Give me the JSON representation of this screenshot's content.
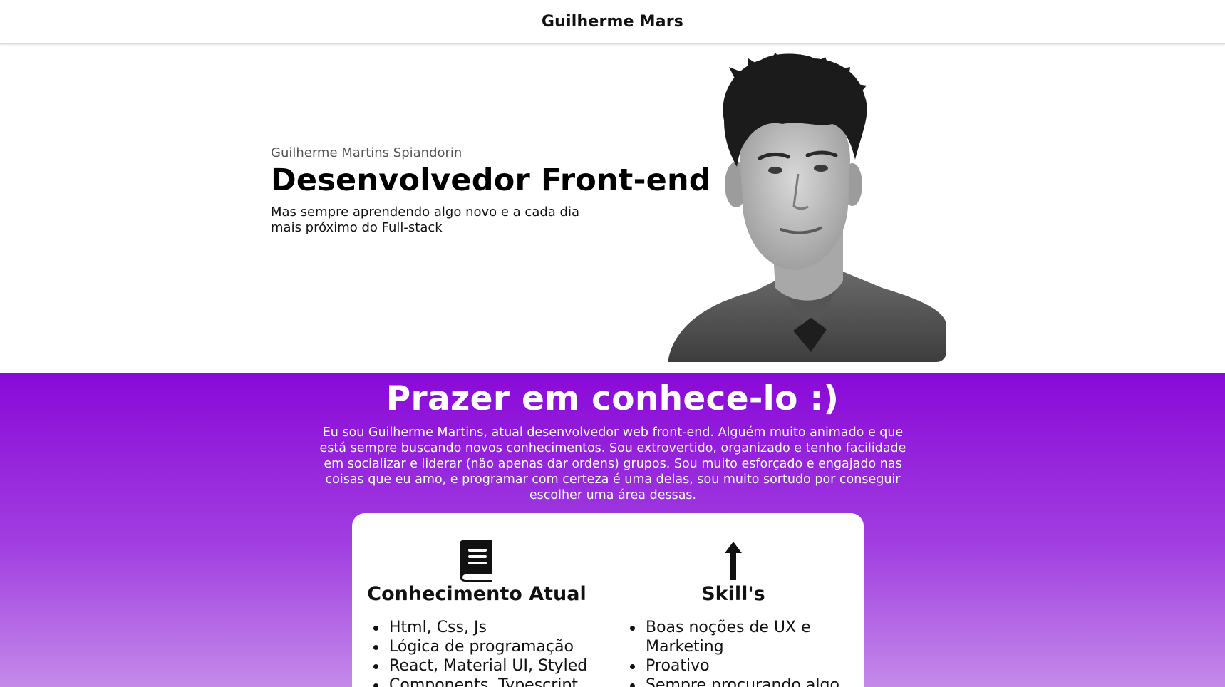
{
  "header": {
    "brand": "Guilherme Mars"
  },
  "hero": {
    "name": "Guilherme Martins Spiandorin",
    "title": "Desenvolvedor Front-end",
    "subtitle": "Mas sempre aprendendo algo novo e a cada dia mais próximo do Full-stack",
    "photo_icon": "profile-photo"
  },
  "about": {
    "title": "Prazer em conhece-lo :)",
    "text": "Eu sou Guilherme Martins, atual desenvolvedor web front-end. Alguém muito animado e que está sempre buscando novos conhecimentos. Sou extrovertido, organizado e tenho facilidade em socializar e liderar (não apenas dar ordens) grupos. Sou muito esforçado e engajado nas coisas que eu amo, e programar com certeza é uma delas, sou muito sortudo por conseguir escolher uma área dessas.",
    "colors": {
      "gradient_top": "#8a09d8",
      "gradient_bottom": "#c48ae8"
    }
  },
  "card": {
    "knowledge": {
      "icon": "book-icon",
      "title": "Conhecimento Atual",
      "items": [
        "Html, Css, Js",
        "Lógica de programação",
        "React, Material UI, Styled",
        "Components, Typescript"
      ]
    },
    "skills": {
      "icon": "arrow-up-icon",
      "title": "Skill's",
      "items": [
        "Boas noções de UX e Marketing",
        "Proativo",
        "Sempre procurando algo novo"
      ]
    }
  }
}
